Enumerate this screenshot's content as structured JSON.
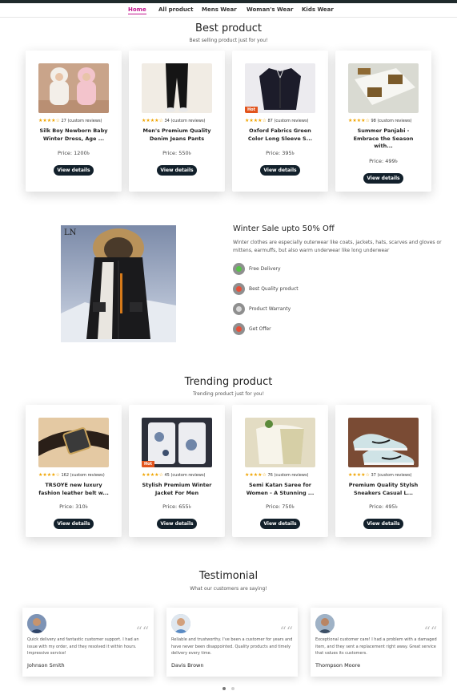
{
  "nav": {
    "items": [
      {
        "label": "Home"
      },
      {
        "label": "All product"
      },
      {
        "label": "Mens Wear"
      },
      {
        "label": "Woman's Wear"
      },
      {
        "label": "Kids Wear"
      }
    ]
  },
  "best": {
    "title": "Best product",
    "subtitle": "Best selling product just for you!",
    "products": [
      {
        "reviews": "27 (custom reviews)",
        "title": "Silk Boy Newborn Baby Winter Dress, Age ...",
        "price": "Price: 1200৳",
        "button": "View details",
        "stars": "★★★★☆"
      },
      {
        "reviews": "34 (custom reviews)",
        "title": "Men's Premium Quality Denim Jeans Pants",
        "price": "Price: 550৳",
        "button": "View details",
        "stars": "★★★★☆"
      },
      {
        "reviews": "87 (custom reviews)",
        "title": "Oxford Fabrics Green Color Long Sleeve S...",
        "price": "Price: 395৳",
        "button": "View details",
        "stars": "★★★★☆",
        "badge": "Hot"
      },
      {
        "reviews": "98 (custom reviews)",
        "title": "Summer Panjabi - Embrace the Season with...",
        "price": "Price: 499৳",
        "button": "View details",
        "stars": "★★★★☆"
      }
    ]
  },
  "winter": {
    "logo": "LN",
    "title": "Winter Sale upto 50% Off",
    "description": "Winter clothes are especially outerwear like coats, jackets, hats, scarves and gloves or mittens, earmuffs, but also warm underwear like long underwear",
    "features": [
      {
        "label": "Free Delivery",
        "icon": "truck-icon",
        "color": "#57c24a"
      },
      {
        "label": "Best Quality product",
        "icon": "quality-icon",
        "color": "#e8503a"
      },
      {
        "label": "Product Warranty",
        "icon": "warranty-icon",
        "color": "#d9d9d9"
      },
      {
        "label": "Get Offer",
        "icon": "offer-icon",
        "color": "#e8503a"
      }
    ]
  },
  "trending": {
    "title": "Trending product",
    "subtitle": "Trending product just for you!",
    "products": [
      {
        "reviews": "162 (custom reviews)",
        "title": "TRSOYE new luxury fashion leather belt w...",
        "price": "Price: 310৳",
        "button": "View details",
        "stars": "★★★★☆"
      },
      {
        "reviews": "45 (custom reviews)",
        "title": "Stylish Premium Winter Jacket For Men",
        "price": "Price: 655৳",
        "button": "View details",
        "stars": "★★★★☆",
        "badge": "Hot"
      },
      {
        "reviews": "76 (custom reviews)",
        "title": "Semi Katan Saree for Women - A Stunning ...",
        "price": "Price: 750৳",
        "button": "View details",
        "stars": "★★★★☆"
      },
      {
        "reviews": "37 (custom reviews)",
        "title": "Premium Quality Stylsh Sneakers Casual L...",
        "price": "Price: 495৳",
        "button": "View details",
        "stars": "★★★★☆"
      }
    ]
  },
  "testimonial": {
    "title": "Testimonial",
    "subtitle": "What our customers are saying!",
    "items": [
      {
        "text": "Quick delivery and fantastic customer support. I had an issue with my order, and they resolved it within hours. Impressive service!",
        "name": "Johnson Smith"
      },
      {
        "text": "Reliable and trustworthy. I've been a customer for years and have never been disappointed. Quality products and timely delivery every time.",
        "name": "Davis Brown"
      },
      {
        "text": "Exceptional customer care! I had a problem with a damaged item, and they sent a replacement right away. Great service that values its customers.",
        "name": "Thompson Moore"
      }
    ]
  },
  "colors": {
    "accent": "#c2178f",
    "button": "#12202b",
    "star": "#f0a400",
    "hot_badge": "#e2541d"
  }
}
